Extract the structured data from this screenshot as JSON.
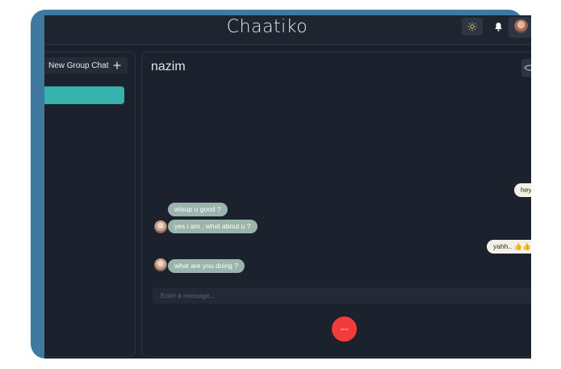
{
  "header": {
    "app_title": "Chaatiko",
    "theme_icon": "sun-icon",
    "notification_icon": "bell-icon"
  },
  "sidebar": {
    "new_group_label": "New Group Chat",
    "new_group_icon": "plus-icon"
  },
  "chat": {
    "contact_name": "nazim",
    "messages": [
      {
        "side": "out",
        "text": "hey"
      },
      {
        "side": "in",
        "text": "wtsup u good ?"
      },
      {
        "side": "in",
        "text": "yes i am , what about u ?"
      },
      {
        "side": "out",
        "text": "yahh.. 👍👍"
      },
      {
        "side": "in",
        "text": "what are you doing ?"
      }
    ],
    "input_placeholder": "Enter a message...",
    "send_label": "send"
  },
  "colors": {
    "accent": "#38b2ac",
    "incoming_bubble": "#9bb5ac",
    "outgoing_bubble": "#f3f0e6",
    "send_button": "#f23b3b",
    "background": "#1b212c",
    "frame_accent": "#3f78a0"
  }
}
